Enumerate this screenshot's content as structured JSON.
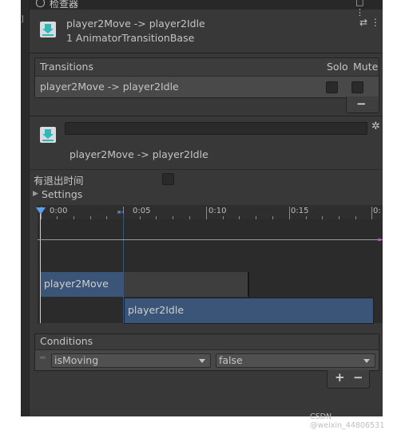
{
  "window": {
    "tab_title": "检查器"
  },
  "header": {
    "transition_title": "player2Move -> player2Idle",
    "subtitle": "1 AnimatorTransitionBase",
    "settings_glyph": "⇄ ⋮",
    "icon": "transition-download-icon"
  },
  "transitions": {
    "heading": "Transitions",
    "solo_label": "Solo",
    "mute_label": "Mute",
    "rows": [
      {
        "label": "player2Move -> player2Idle",
        "solo": false,
        "mute": false
      }
    ],
    "remove_label": "−"
  },
  "detail": {
    "name_value": "",
    "title": "player2Move -> player2Idle",
    "gear_icon": "gear-icon"
  },
  "has_exit_time": {
    "label": "有退出时间",
    "checked": false
  },
  "settings": {
    "label": "Settings",
    "expanded": false
  },
  "timeline": {
    "ticks": [
      "0:00",
      "0:05",
      "0:10",
      "0:15",
      "0:"
    ],
    "source_state": "player2Move",
    "dest_state": "player2Idle"
  },
  "conditions": {
    "heading": "Conditions",
    "items": [
      {
        "parameter": "isMoving",
        "value": "false"
      }
    ],
    "add_label": "+",
    "remove_label": "−"
  },
  "watermark": "CSDN @weixin_44806531",
  "colors": {
    "panel_bg": "#383838",
    "accent_teal": "#2fb8b8",
    "state_bar_blue": "#3a5577",
    "text": "#c4c4c4"
  }
}
